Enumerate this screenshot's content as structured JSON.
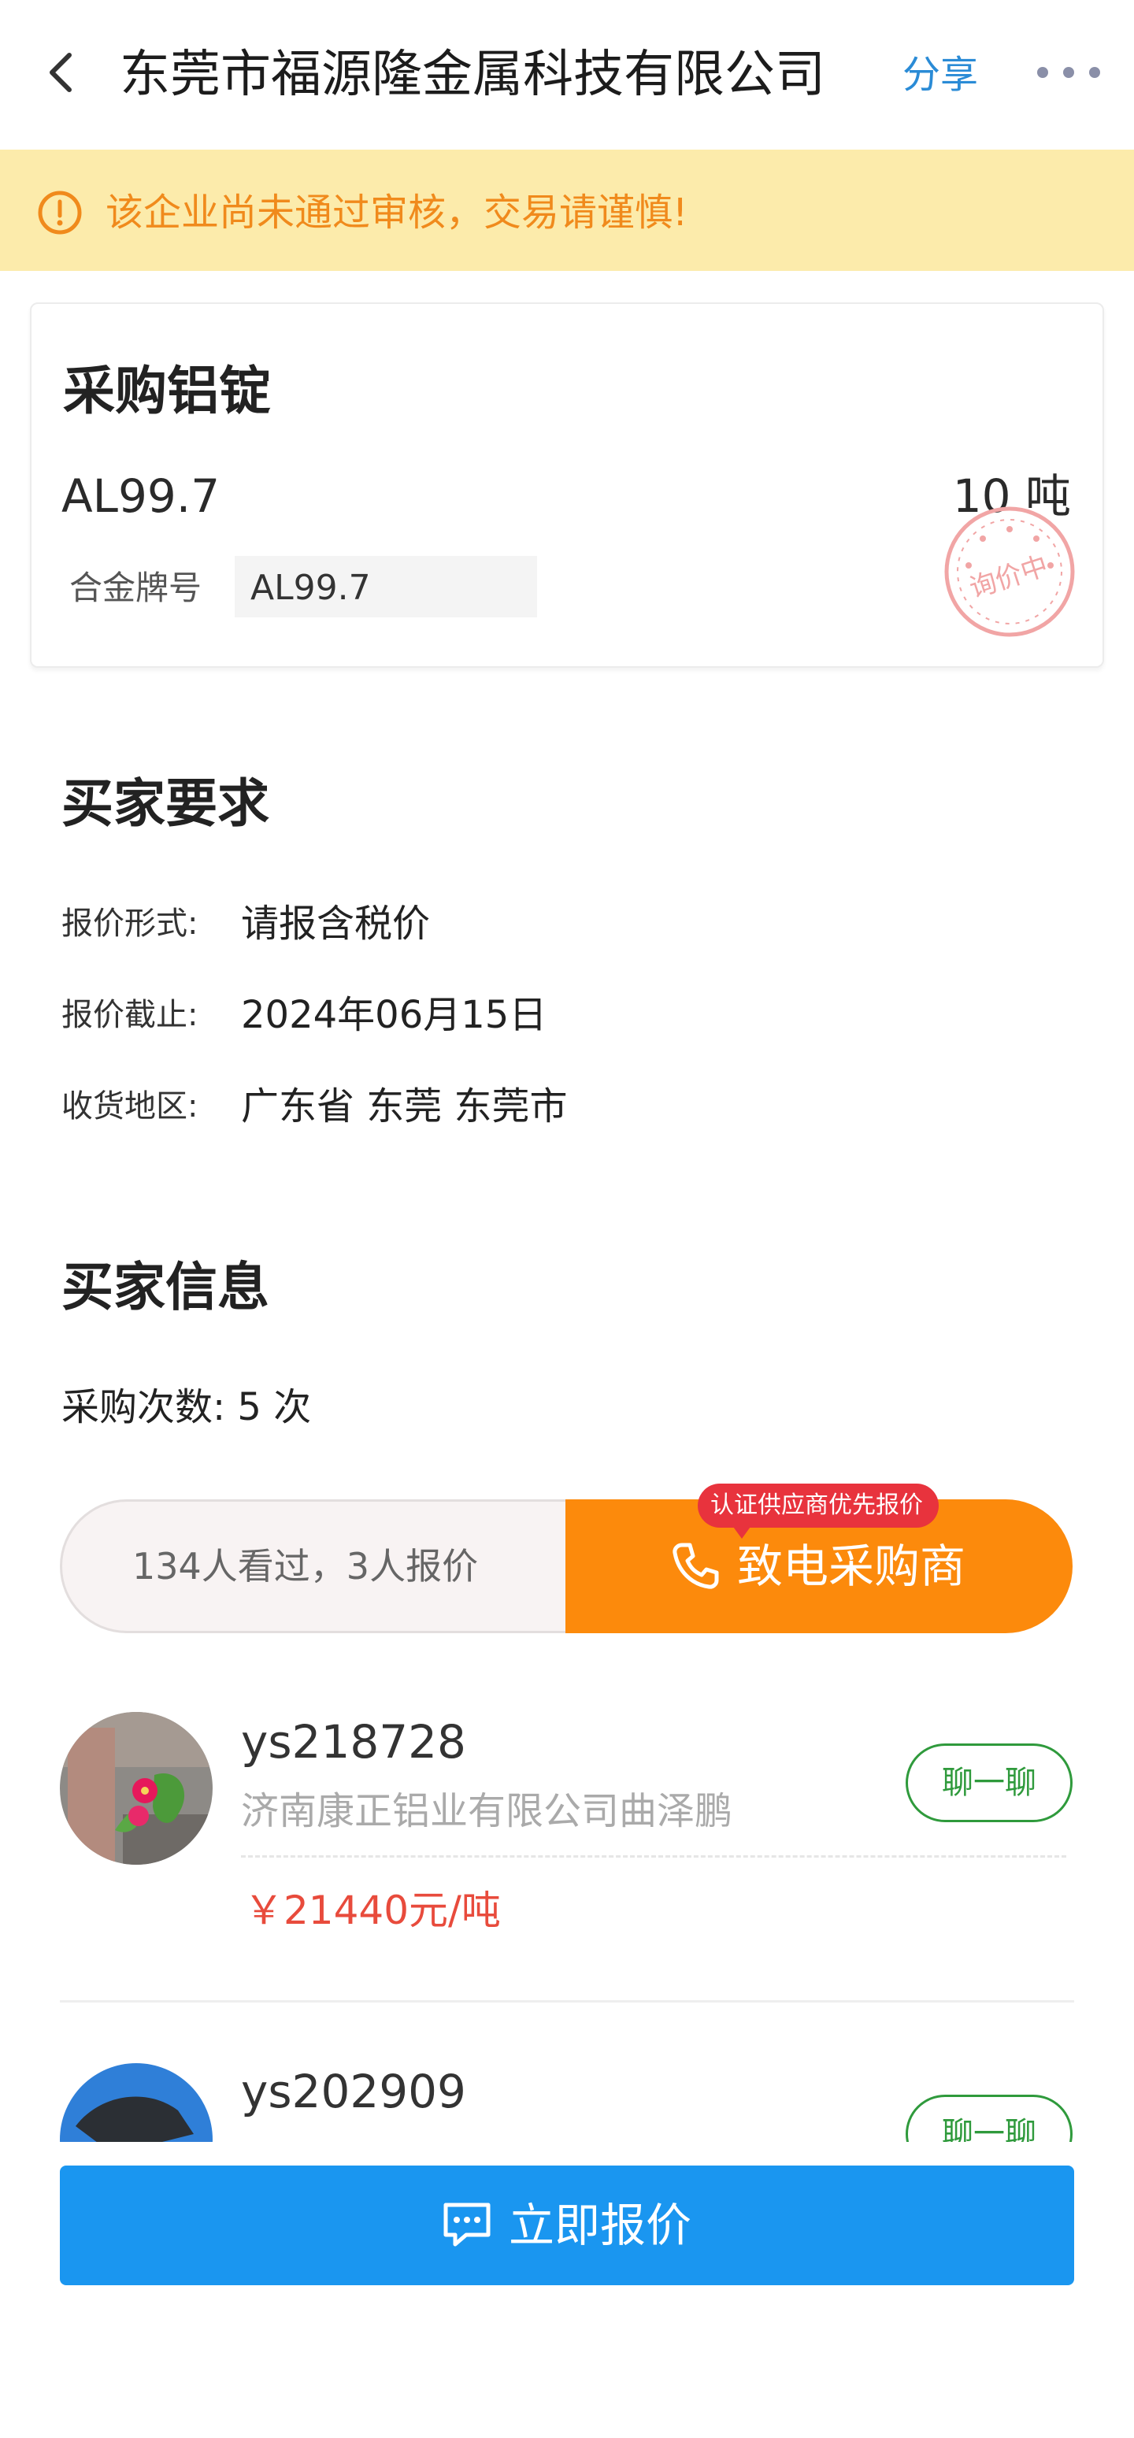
{
  "header": {
    "title": "东莞市福源隆金属科技有限公司",
    "share_label": "分享",
    "back_icon": "chevron-left-icon",
    "more_icon": "more-dots-icon"
  },
  "warning": {
    "text": "该企业尚未通过审核，交易请谨慎!",
    "icon": "warning-circle-icon",
    "color": "#f08a1c",
    "background": "#fcebab"
  },
  "purchase": {
    "title": "采购铝锭",
    "product_code": "AL99.7",
    "quantity": "10 吨",
    "alloy_label": "合金牌号",
    "alloy_value": "AL99.7",
    "stamp_text": "询价中"
  },
  "requirements": {
    "section_title": "买家要求",
    "items": [
      {
        "label": "报价形式:",
        "value": "请报含税价"
      },
      {
        "label": "报价截止:",
        "value": "2024年06月15日"
      },
      {
        "label": "收货地区:",
        "value": "广东省 东莞 东莞市"
      }
    ]
  },
  "buyer_info": {
    "section_title": "买家信息",
    "purchase_count": "采购次数: 5 次"
  },
  "actions": {
    "stats_text": "134人看过，3人报价",
    "call_label": "致电采购商",
    "priority_badge": "认证供应商优先报价",
    "call_color": "#fc8a0c"
  },
  "quotes": [
    {
      "name": "ys218728",
      "company": "济南康正铝业有限公司曲泽鹏",
      "price": "￥21440元/吨",
      "chat_label": "聊一聊"
    },
    {
      "name": "ys202909",
      "company": "",
      "price": "",
      "chat_label": "聊一聊"
    }
  ],
  "bottom": {
    "quote_now_label": "立即报价",
    "quote_now_color": "#1a96f0"
  }
}
